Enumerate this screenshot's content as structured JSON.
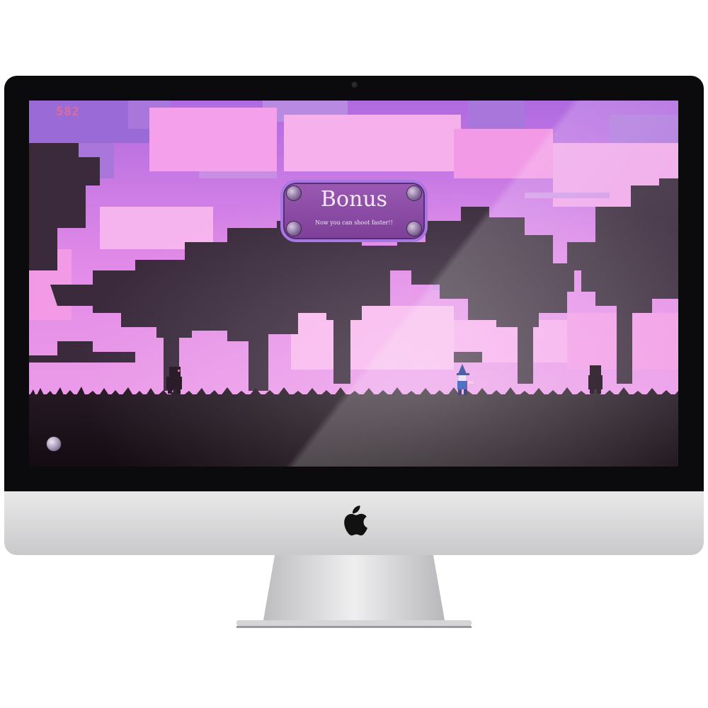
{
  "game": {
    "score": "582",
    "bonus": {
      "title": "Bonus",
      "message": "Now you can shoot faster!!"
    }
  },
  "colors": {
    "sky_pink": "#f08ae8",
    "sky_purple": "#9a6ad6",
    "silhouette": "#3a2a3c",
    "ground": "#1a1118",
    "score_text": "#e06a9a",
    "bonus_panel": "#8a4aa8"
  },
  "icons": {
    "apple": "apple-logo",
    "orb": "orb-icon",
    "bubble": "bubble-decoration"
  }
}
